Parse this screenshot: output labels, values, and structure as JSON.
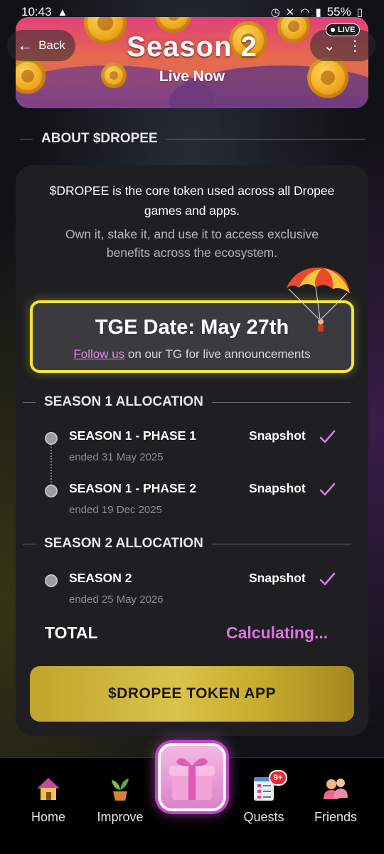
{
  "status_bar": {
    "time": "10:43",
    "battery": "55%"
  },
  "banner": {
    "title": "Season 2",
    "subtitle": "Live Now",
    "back_label": "Back",
    "live_label": "LIVE"
  },
  "about": {
    "heading": "ABOUT $DROPEE",
    "description": "$DROPEE is the core token used across all Dropee games and apps.",
    "description2": "Own it, stake it, and use it to access exclusive benefits across the ecosystem."
  },
  "tge": {
    "title": "TGE Date: May 27th",
    "link_text": "Follow us",
    "subtitle_rest": " on our TG for live announcements"
  },
  "season1": {
    "heading": "SEASON 1 ALLOCATION",
    "items": [
      {
        "title": "SEASON 1 - PHASE 1",
        "date": "ended 31 May 2025",
        "status": "Snapshot"
      },
      {
        "title": "SEASON 1 - PHASE 2",
        "date": "ended 19 Dec 2025",
        "status": "Snapshot"
      }
    ]
  },
  "season2": {
    "heading": "SEASON 2 ALLOCATION",
    "items": [
      {
        "title": "SEASON 2",
        "date": "ended 25 May 2026",
        "status": "Snapshot"
      }
    ]
  },
  "total": {
    "label": "TOTAL",
    "value": "Calculating..."
  },
  "token_button": {
    "label": "$DROPEE TOKEN APP"
  },
  "nav": {
    "home": "Home",
    "improve": "Improve",
    "quests": "Quests",
    "quests_badge": "9+",
    "friends": "Friends"
  },
  "colors": {
    "accent_yellow": "#f2e63a",
    "accent_pink": "#e070e8",
    "button_gold": "#c8ad2c"
  },
  "icons": [
    "back-arrow-icon",
    "chevron-down-icon",
    "more-vert-icon",
    "parachute-icon",
    "check-icon",
    "home-icon",
    "sprout-icon",
    "gift-icon",
    "quests-icon",
    "friends-icon"
  ]
}
